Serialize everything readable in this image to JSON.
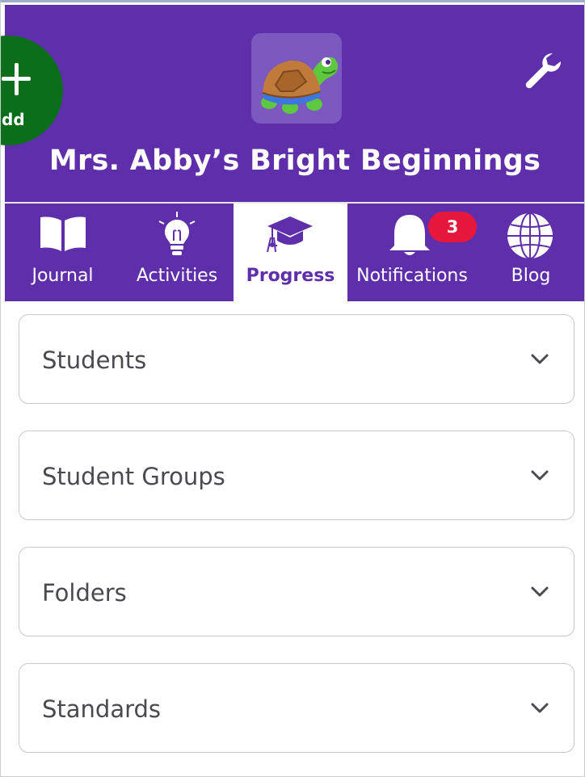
{
  "header": {
    "add_label": "dd",
    "title": "Mrs. Abby’s Bright Beginnings",
    "settings_icon": "wrench-icon",
    "logo_icon": "turtle-logo"
  },
  "tabs": [
    {
      "label": "Journal",
      "icon": "book-icon"
    },
    {
      "label": "Activities",
      "icon": "lightbulb-icon"
    },
    {
      "label": "Progress",
      "icon": "graduation-cap-icon",
      "active": true
    },
    {
      "label": "Notifications",
      "icon": "bell-icon",
      "badge": "3"
    },
    {
      "label": "Blog",
      "icon": "globe-icon"
    }
  ],
  "sections": [
    {
      "label": "Students"
    },
    {
      "label": "Student Groups"
    },
    {
      "label": "Folders"
    },
    {
      "label": "Standards"
    }
  ],
  "colors": {
    "brand_purple": "#5f2eaa",
    "add_green": "#0b6e1b",
    "badge_red": "#e7173b"
  }
}
